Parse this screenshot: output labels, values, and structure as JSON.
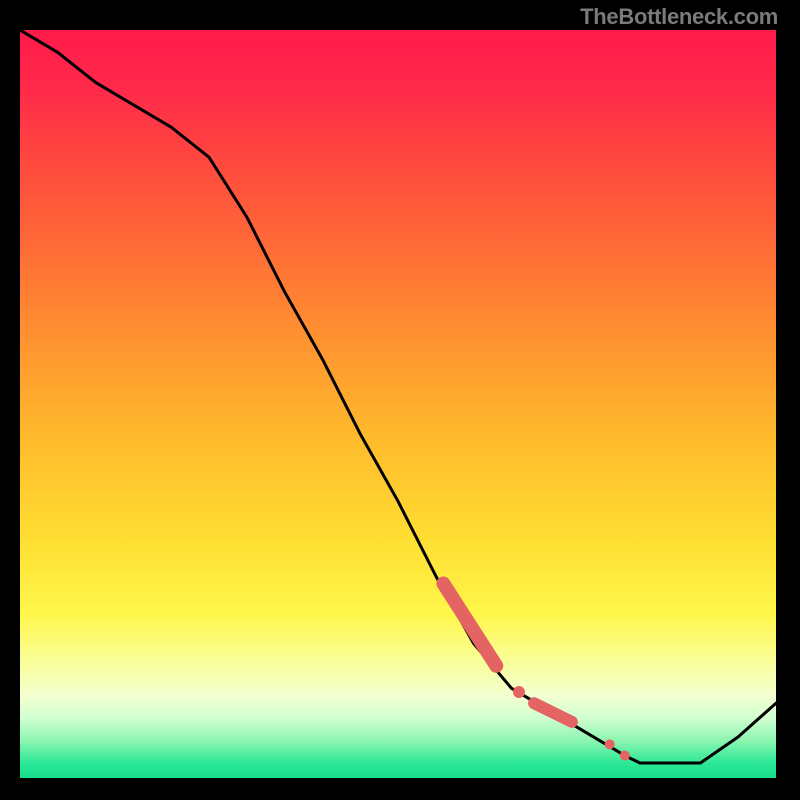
{
  "watermark": "TheBottleneck.com",
  "colors": {
    "background": "#000000",
    "watermark_text": "#7a7a7a",
    "line": "#000000",
    "marker": "#e46464"
  },
  "chart_data": {
    "type": "line",
    "title": "",
    "xlabel": "",
    "ylabel": "",
    "xlim": [
      0,
      100
    ],
    "ylim": [
      0,
      100
    ],
    "series": [
      {
        "name": "curve",
        "x": [
          0,
          5,
          10,
          15,
          20,
          25,
          30,
          35,
          40,
          45,
          50,
          55,
          60,
          65,
          70,
          75,
          80,
          82,
          85,
          90,
          95,
          100
        ],
        "values": [
          100,
          97,
          93,
          90,
          87,
          83,
          75,
          65,
          56,
          46,
          37,
          27,
          18,
          12,
          9,
          6,
          3,
          2,
          2,
          2,
          5.5,
          10
        ]
      }
    ],
    "markers": [
      {
        "name": "band-a-start",
        "x": 56,
        "y": 26
      },
      {
        "name": "band-a-end",
        "x": 63,
        "y": 15
      },
      {
        "name": "dot-b",
        "x": 66,
        "y": 11.5
      },
      {
        "name": "band-c-start",
        "x": 68,
        "y": 10
      },
      {
        "name": "band-c-end",
        "x": 73,
        "y": 7.5
      },
      {
        "name": "dot-d",
        "x": 78,
        "y": 4.5
      },
      {
        "name": "dot-e",
        "x": 80,
        "y": 3
      }
    ],
    "gradient_stops": [
      {
        "offset": 0.0,
        "color": "#ff1a4a"
      },
      {
        "offset": 0.08,
        "color": "#ff2a4a"
      },
      {
        "offset": 0.18,
        "color": "#ff4a3e"
      },
      {
        "offset": 0.3,
        "color": "#ff6e36"
      },
      {
        "offset": 0.42,
        "color": "#ff9530"
      },
      {
        "offset": 0.55,
        "color": "#ffbb2c"
      },
      {
        "offset": 0.68,
        "color": "#ffde32"
      },
      {
        "offset": 0.78,
        "color": "#fff64a"
      },
      {
        "offset": 0.85,
        "color": "#f9ffa0"
      },
      {
        "offset": 0.89,
        "color": "#f3ffd0"
      },
      {
        "offset": 0.92,
        "color": "#d0ffd0"
      },
      {
        "offset": 0.95,
        "color": "#8cf5b0"
      },
      {
        "offset": 0.98,
        "color": "#2ce897"
      },
      {
        "offset": 1.0,
        "color": "#15dd8a"
      }
    ]
  }
}
